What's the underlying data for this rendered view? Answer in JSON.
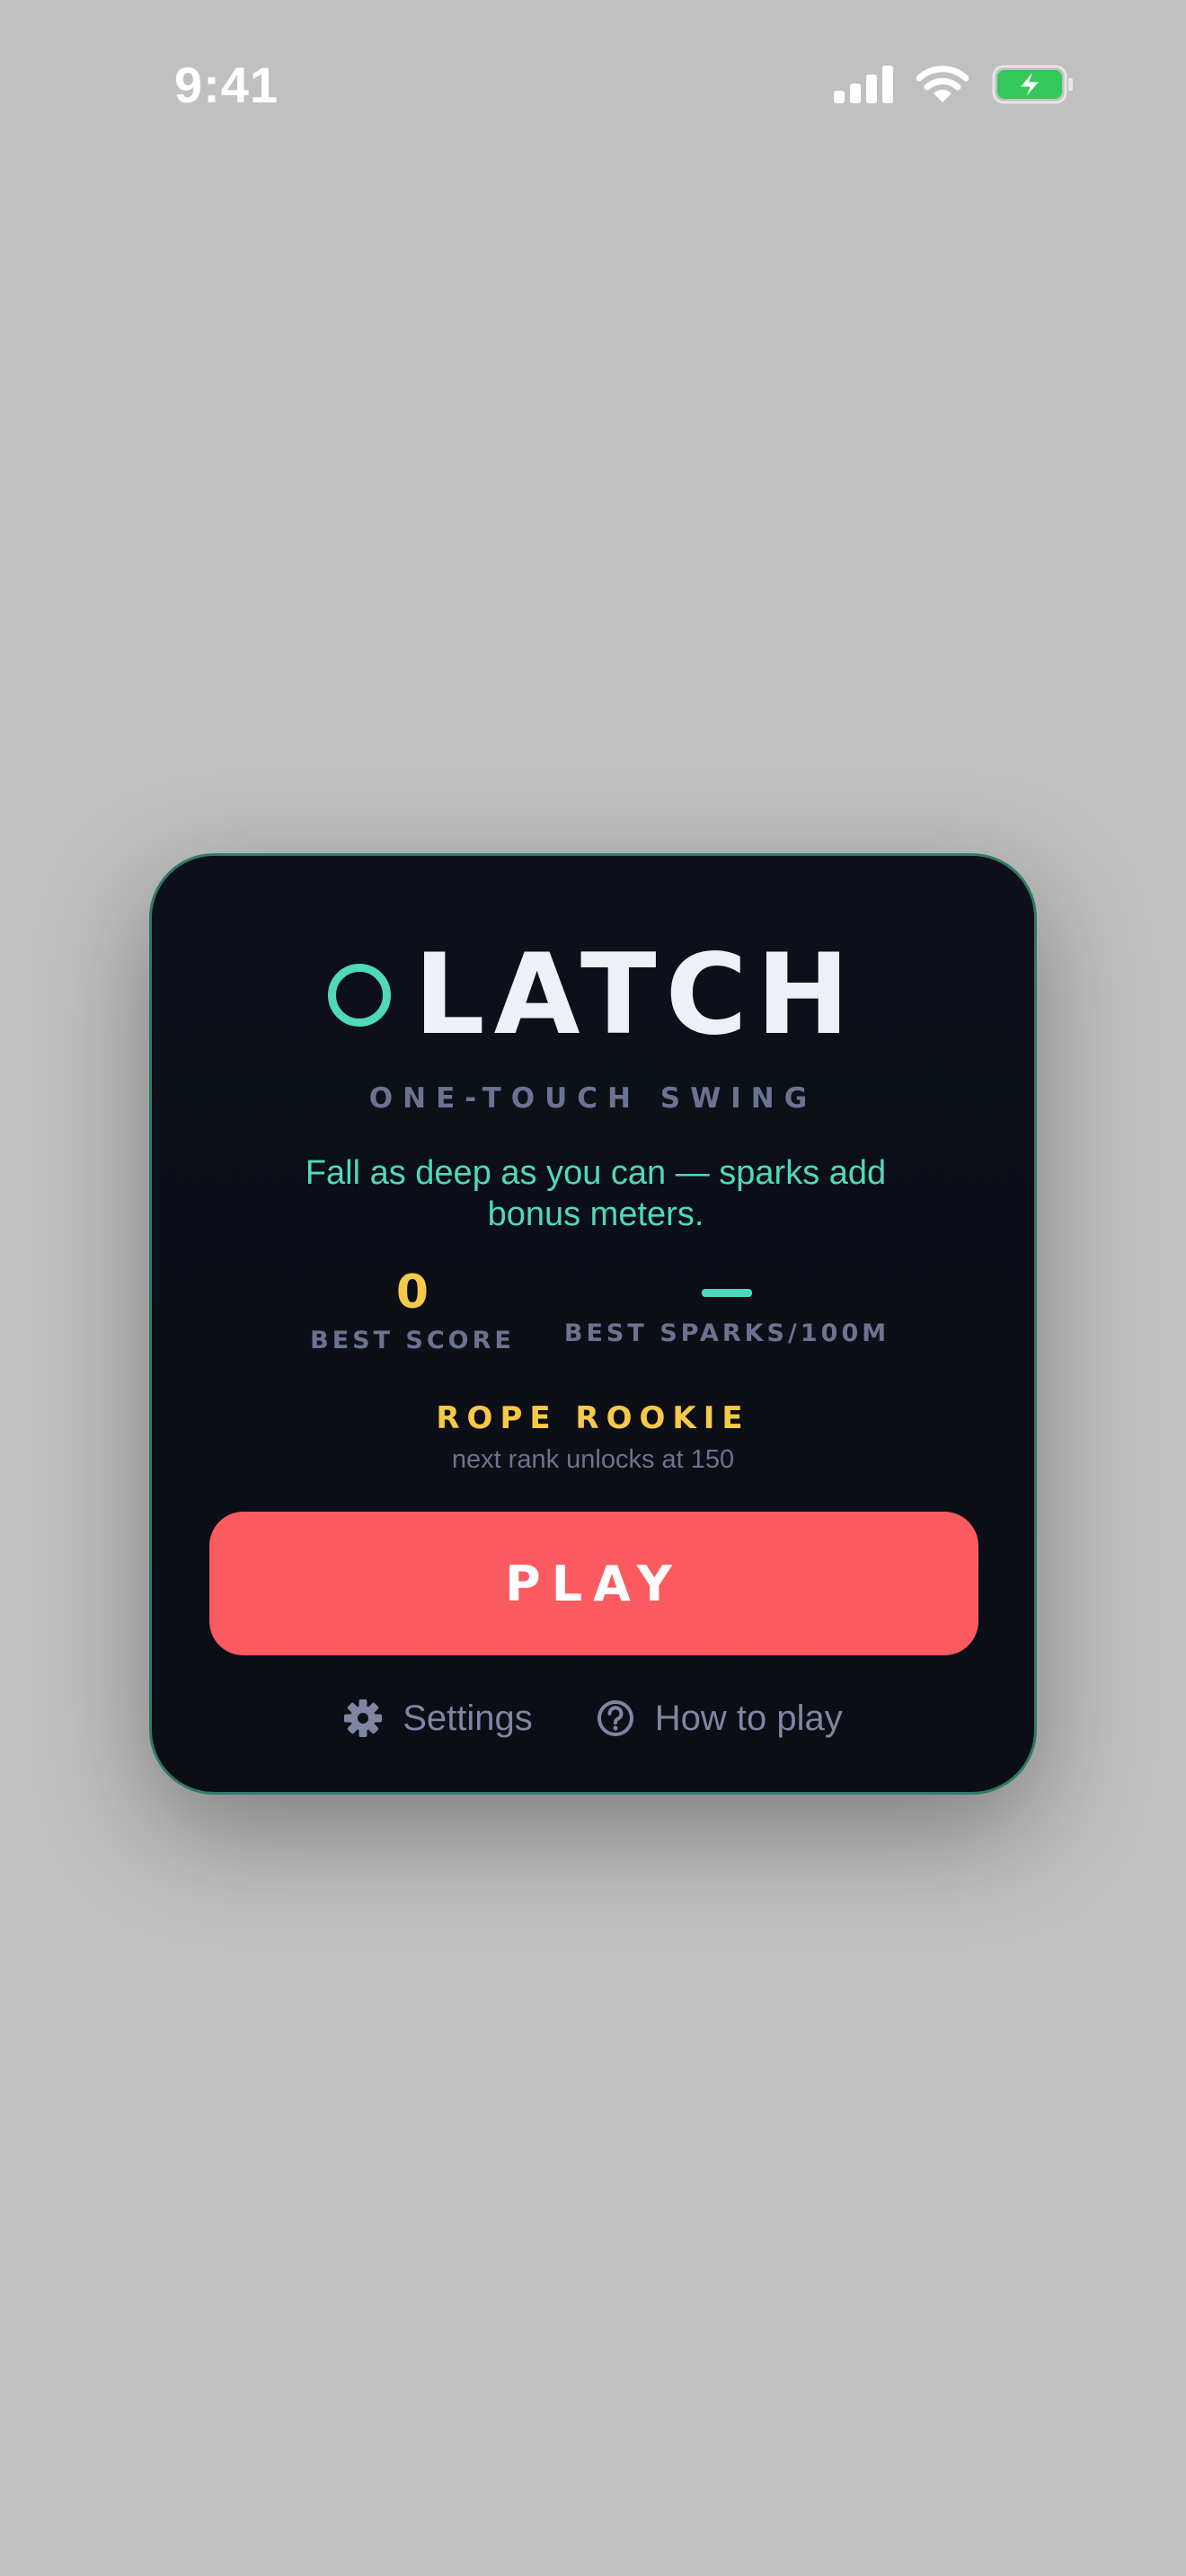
{
  "status_bar": {
    "time": "9:41",
    "icons": [
      "cellular-signal-icon",
      "wifi-icon",
      "battery-charging-icon"
    ]
  },
  "game": {
    "title": "LATCH",
    "logo_icon": "ring-icon",
    "subtitle": "ONE-TOUCH SWING",
    "tagline": "Fall as deep as you can — sparks add bonus meters.",
    "stats": {
      "best_score": {
        "value": "0",
        "label": "BEST SCORE"
      },
      "best_sparks": {
        "value": "—",
        "label": "BEST SPARKS/100M"
      }
    },
    "rank": {
      "title": "ROPE ROOKIE",
      "next": "next rank unlocks at 150"
    },
    "play_label": "PLAY",
    "links": {
      "settings": {
        "label": "Settings",
        "icon": "gear-icon"
      },
      "how_to_play": {
        "label": "How to play",
        "icon": "question-circle-icon"
      }
    }
  },
  "colors": {
    "background": "#c0c0c0",
    "card": "#0c0f16",
    "card_border": "#2f7a69",
    "accent_teal": "#4fd9b8",
    "accent_gold": "#f5c94a",
    "play_button": "#fb5a60",
    "muted": "#6c7391"
  }
}
